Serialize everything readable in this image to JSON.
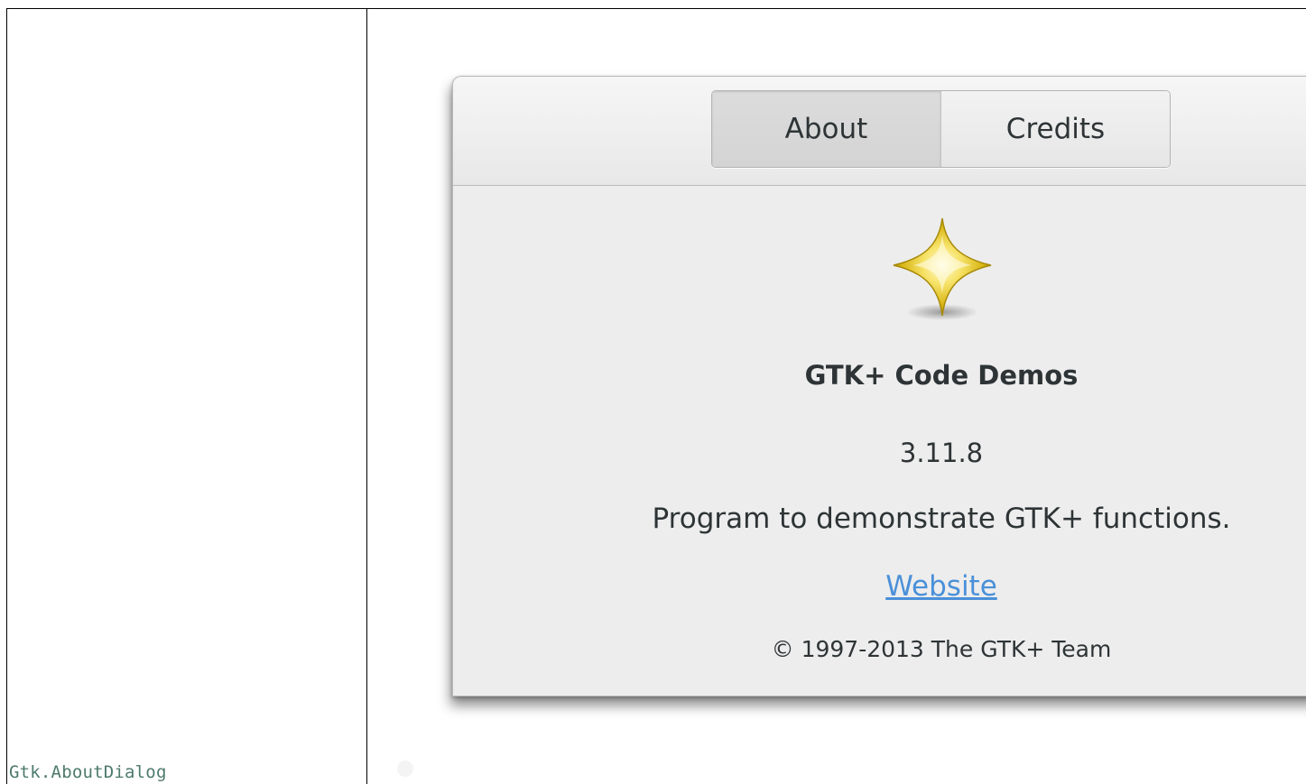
{
  "left_panel": {
    "caption": "Gtk.AboutDialog"
  },
  "dialog": {
    "tabs": [
      {
        "label": "About",
        "active": true
      },
      {
        "label": "Credits",
        "active": false
      }
    ],
    "logo_icon": "gold-star-icon",
    "program_name": "GTK+ Code Demos",
    "version": "3.11.8",
    "comments": "Program to demonstrate GTK+ functions.",
    "website_label": "Website",
    "copyright": "© 1997-2013 The GTK+ Team"
  },
  "colors": {
    "link": "#4a90d9",
    "caption_text": "#4e7a6d",
    "dialog_bg": "#ededed"
  }
}
